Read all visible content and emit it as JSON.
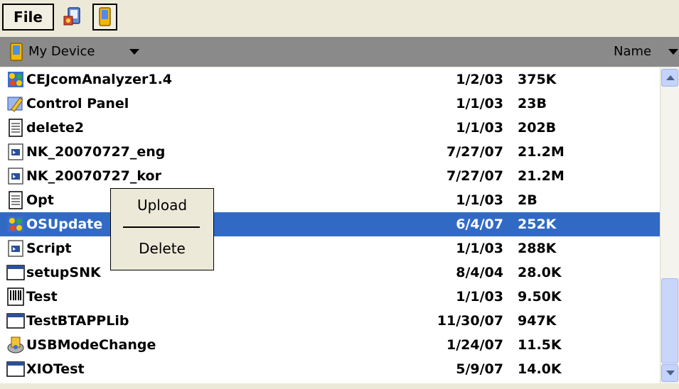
{
  "toolbar": {
    "file_label": "File",
    "icons": [
      "device-properties-icon",
      "pda-device-icon"
    ]
  },
  "navbar": {
    "location": "My Device",
    "sort": "Name"
  },
  "files": [
    {
      "name": "CEJcomAnalyzer1.4",
      "date": "1/2/03",
      "size": "375K",
      "icon": "app-icon"
    },
    {
      "name": "Control Panel",
      "date": "1/1/03",
      "size": "23B",
      "icon": "control-panel-icon"
    },
    {
      "name": "delete2",
      "date": "1/1/03",
      "size": "202B",
      "icon": "text-document-icon"
    },
    {
      "name": "NK_20070727_eng",
      "date": "7/27/07",
      "size": "21.2M",
      "icon": "script-icon"
    },
    {
      "name": "NK_20070727_kor",
      "date": "7/27/07",
      "size": "21.2M",
      "icon": "script-icon"
    },
    {
      "name": "Opt",
      "date": "1/1/03",
      "size": "2B",
      "icon": "text-document-icon"
    },
    {
      "name": "OSUpdate",
      "date": "6/4/07",
      "size": "252K",
      "icon": "app-icon",
      "selected": true
    },
    {
      "name": "Script",
      "date": "1/1/03",
      "size": "288K",
      "icon": "script-icon"
    },
    {
      "name": "setupSNK",
      "date": "8/4/04",
      "size": "28.0K",
      "icon": "window-app-icon"
    },
    {
      "name": "Test",
      "date": "1/1/03",
      "size": "9.50K",
      "icon": "barcode-icon"
    },
    {
      "name": "TestBTAPPLib",
      "date": "11/30/07",
      "size": "947K",
      "icon": "window-app-icon"
    },
    {
      "name": "USBModeChange",
      "date": "1/24/07",
      "size": "11.5K",
      "icon": "installer-icon"
    },
    {
      "name": "XIOTest",
      "date": "5/9/07",
      "size": "14.0K",
      "icon": "window-app-icon"
    }
  ],
  "context_menu": {
    "upload": "Upload",
    "delete": "Delete"
  },
  "colors": {
    "selection": "#316ac5",
    "navbar": "#8a8a8a",
    "chrome": "#ece9d8"
  }
}
